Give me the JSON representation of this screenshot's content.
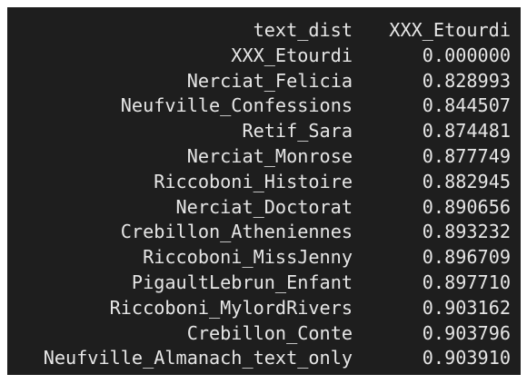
{
  "header": {
    "index_name": "text_dist",
    "column_name": "XXX_Etourdi"
  },
  "rows": [
    {
      "label": "XXX_Etourdi",
      "value": "0.000000"
    },
    {
      "label": "Nerciat_Felicia",
      "value": "0.828993"
    },
    {
      "label": "Neufville_Confessions",
      "value": "0.844507"
    },
    {
      "label": "Retif_Sara",
      "value": "0.874481"
    },
    {
      "label": "Nerciat_Monrose",
      "value": "0.877749"
    },
    {
      "label": "Riccoboni_Histoire",
      "value": "0.882945"
    },
    {
      "label": "Nerciat_Doctorat",
      "value": "0.890656"
    },
    {
      "label": "Crebillon_Atheniennes",
      "value": "0.893232"
    },
    {
      "label": "Riccoboni_MissJenny",
      "value": "0.896709"
    },
    {
      "label": "PigaultLebrun_Enfant",
      "value": "0.897710"
    },
    {
      "label": "Riccoboni_MylordRivers",
      "value": "0.903162"
    },
    {
      "label": "Crebillon_Conte",
      "value": "0.903796"
    },
    {
      "label": "Neufville_Almanach_text_only",
      "value": "0.903910"
    }
  ]
}
